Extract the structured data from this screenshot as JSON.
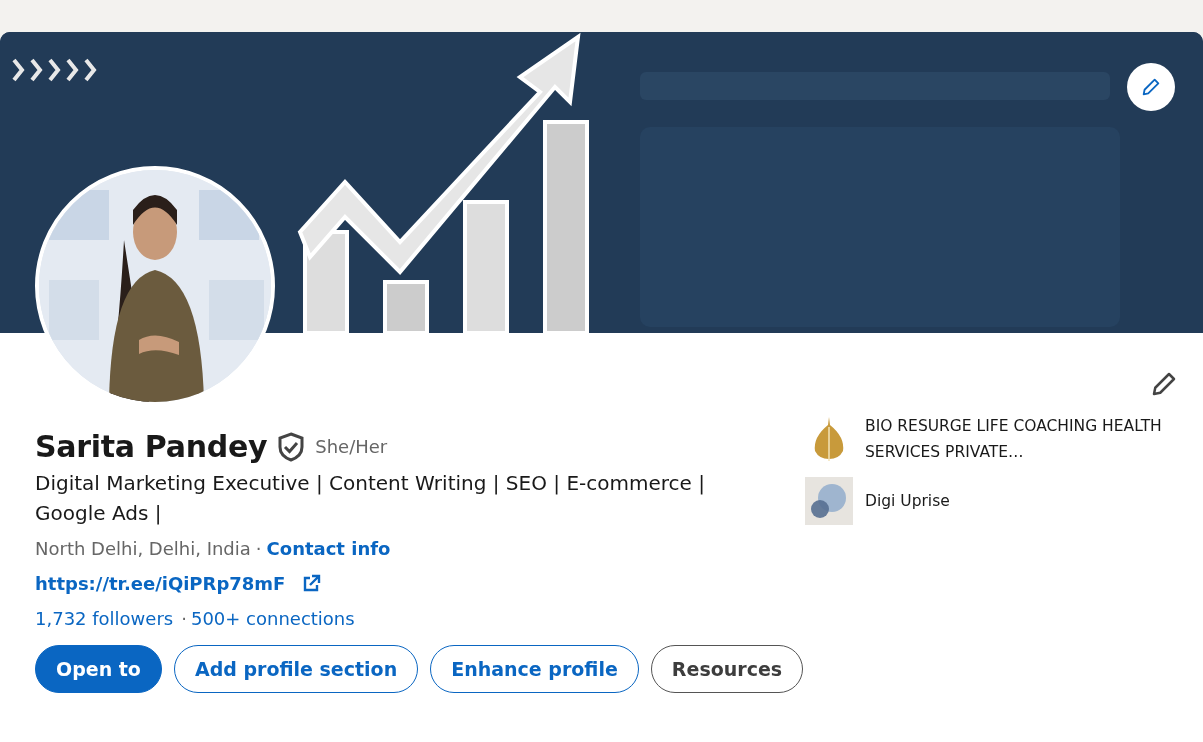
{
  "banner": {
    "edit_button": true
  },
  "profile": {
    "name": "Sarita Pandey",
    "verified": true,
    "pronouns": "She/Her",
    "headline": "Digital Marketing Executive | Content Writing | SEO | E-commerce | Google Ads |",
    "location": "North Delhi, Delhi, India",
    "separator": "·",
    "contact_link": "Contact info",
    "website": "https://tr.ee/iQiPRp78mF",
    "followers": "1,732 followers",
    "connections_separator": "·",
    "connections": "500+ connections"
  },
  "buttons": [
    {
      "label": "Open to",
      "kind": "primary"
    },
    {
      "label": "Add profile section",
      "kind": "outline"
    },
    {
      "label": "Enhance profile",
      "kind": "outline"
    },
    {
      "label": "Resources",
      "kind": "secondary"
    }
  ],
  "organizations": [
    {
      "name": "BIO RESURGE LIFE COACHING HEALTH SERVICES PRIVATE…",
      "kind": "leaf"
    },
    {
      "name": "Digi Uprise",
      "kind": "circles"
    }
  ]
}
